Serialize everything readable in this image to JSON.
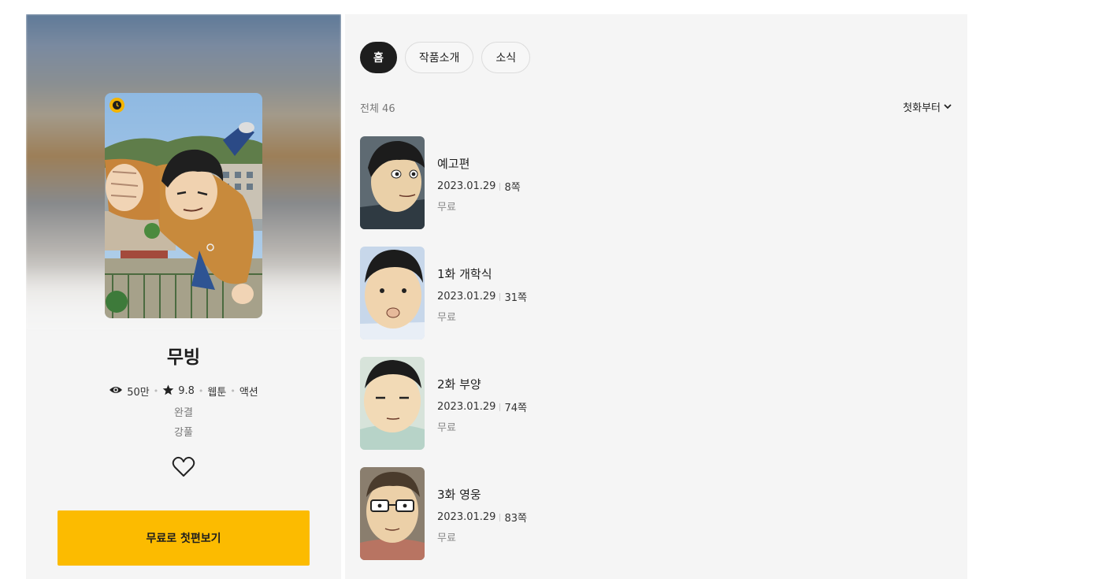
{
  "series": {
    "title": "무빙",
    "views": "50만",
    "rating": "9.8",
    "type": "웹툰",
    "genre": "액션",
    "status": "완결",
    "author": "강풀",
    "cta_label": "무료로 첫편보기"
  },
  "tabs": [
    {
      "label": "홈",
      "active": true
    },
    {
      "label": "작품소개",
      "active": false
    },
    {
      "label": "소식",
      "active": false
    }
  ],
  "list": {
    "total_label": "전체 46",
    "sort_label": "첫화부터"
  },
  "episodes": [
    {
      "title": "예고편",
      "date": "2023.01.29",
      "pages": "8쪽",
      "price": "무료"
    },
    {
      "title": "1화 개학식",
      "date": "2023.01.29",
      "pages": "31쪽",
      "price": "무료"
    },
    {
      "title": "2화 부양",
      "date": "2023.01.29",
      "pages": "74쪽",
      "price": "무료"
    },
    {
      "title": "3화 영웅",
      "date": "2023.01.29",
      "pages": "83쪽",
      "price": "무료"
    }
  ],
  "colors": {
    "accent": "#fcbb00",
    "panel_bg": "#f5f5f5",
    "active_tab": "#1e1e1e"
  }
}
